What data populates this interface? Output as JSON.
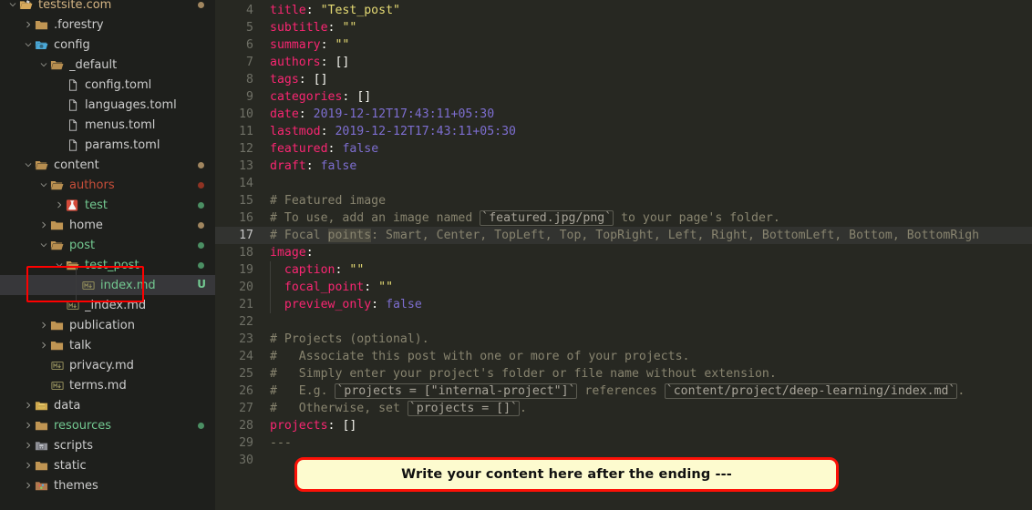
{
  "theme": {
    "sidebar_bg": "#1e1f1c",
    "editor_bg": "#272822",
    "selected_row_bg": "#37373a",
    "active_line_bg": "#323330",
    "annotation_red": "#ff0000",
    "callout_bg": "#fdfbcf",
    "callout_border": "#fc1107",
    "accent_green": "#73c991",
    "accent_red": "#c74e39",
    "accent_tan": "#d4b483"
  },
  "sidebar": {
    "name": "file-explorer",
    "items": [
      {
        "label": "",
        "indent": 0,
        "twisty": "none",
        "icon": "folder-icon",
        "icon_color": "#c09553",
        "label_class": "c-default",
        "dot": null,
        "badge": null,
        "selected": false,
        "partial_top": true
      },
      {
        "label": "testsite.com",
        "indent": 0,
        "twisty": "down",
        "icon": "folder-open-root-icon",
        "icon_color": "#d7a95c",
        "label_class": "c-tan",
        "dot": "#a1865f",
        "badge": null,
        "selected": false
      },
      {
        "label": ".forestry",
        "indent": 1,
        "twisty": "right",
        "icon": "folder-icon",
        "icon_color": "#c09553",
        "label_class": "c-default",
        "dot": null,
        "badge": null,
        "selected": false
      },
      {
        "label": "config",
        "indent": 1,
        "twisty": "down",
        "icon": "folder-config-icon",
        "icon_color": "#4aa8d8",
        "label_class": "c-default",
        "dot": null,
        "badge": null,
        "selected": false
      },
      {
        "label": "_default",
        "indent": 2,
        "twisty": "down",
        "icon": "folder-open-icon",
        "icon_color": "#c09553",
        "label_class": "c-default",
        "dot": null,
        "badge": null,
        "selected": false
      },
      {
        "label": "config.toml",
        "indent": 3,
        "twisty": "none",
        "icon": "file-icon",
        "icon_color": "#c8c8c8",
        "label_class": "c-default",
        "dot": null,
        "badge": null,
        "selected": false
      },
      {
        "label": "languages.toml",
        "indent": 3,
        "twisty": "none",
        "icon": "file-icon",
        "icon_color": "#c8c8c8",
        "label_class": "c-default",
        "dot": null,
        "badge": null,
        "selected": false
      },
      {
        "label": "menus.toml",
        "indent": 3,
        "twisty": "none",
        "icon": "file-icon",
        "icon_color": "#c8c8c8",
        "label_class": "c-default",
        "dot": null,
        "badge": null,
        "selected": false
      },
      {
        "label": "params.toml",
        "indent": 3,
        "twisty": "none",
        "icon": "file-icon",
        "icon_color": "#c8c8c8",
        "label_class": "c-default",
        "dot": null,
        "badge": null,
        "selected": false
      },
      {
        "label": "content",
        "indent": 1,
        "twisty": "down",
        "icon": "folder-open-icon",
        "icon_color": "#c09553",
        "label_class": "c-default",
        "dot": "#a1865f",
        "badge": null,
        "selected": false
      },
      {
        "label": "authors",
        "indent": 2,
        "twisty": "down",
        "icon": "folder-open-icon",
        "icon_color": "#c09553",
        "label_class": "c-red",
        "dot": "#8f3323",
        "badge": null,
        "selected": false
      },
      {
        "label": "test",
        "indent": 3,
        "twisty": "right",
        "icon": "flask-test-icon",
        "icon_color": "#d44a3a",
        "label_class": "c-green",
        "dot": "#4b8f63",
        "badge": null,
        "selected": false
      },
      {
        "label": "home",
        "indent": 2,
        "twisty": "right",
        "icon": "folder-icon",
        "icon_color": "#c09553",
        "label_class": "c-default",
        "dot": "#a1865f",
        "badge": null,
        "selected": false
      },
      {
        "label": "post",
        "indent": 2,
        "twisty": "down",
        "icon": "folder-open-icon",
        "icon_color": "#c09553",
        "label_class": "c-green",
        "dot": "#4b8f63",
        "badge": null,
        "selected": false
      },
      {
        "label": "test_post",
        "indent": 3,
        "twisty": "down",
        "icon": "folder-open-icon",
        "icon_color": "#c09553",
        "label_class": "c-green",
        "dot": "#4b8f63",
        "badge": null,
        "selected": false
      },
      {
        "label": "index.md",
        "indent": 4,
        "twisty": "none",
        "icon": "markdown-icon",
        "icon_color": "#8f8a5a",
        "label_class": "c-green",
        "dot": null,
        "badge": "U",
        "selected": true
      },
      {
        "label": "_index.md",
        "indent": 3,
        "twisty": "none",
        "icon": "markdown-icon",
        "icon_color": "#8f8a5a",
        "label_class": "c-default",
        "dot": null,
        "badge": null,
        "selected": false
      },
      {
        "label": "publication",
        "indent": 2,
        "twisty": "right",
        "icon": "folder-icon",
        "icon_color": "#c09553",
        "label_class": "c-default",
        "dot": null,
        "badge": null,
        "selected": false
      },
      {
        "label": "talk",
        "indent": 2,
        "twisty": "right",
        "icon": "folder-icon",
        "icon_color": "#c09553",
        "label_class": "c-default",
        "dot": null,
        "badge": null,
        "selected": false
      },
      {
        "label": "privacy.md",
        "indent": 2,
        "twisty": "none",
        "icon": "markdown-icon",
        "icon_color": "#8f8a5a",
        "label_class": "c-default",
        "dot": null,
        "badge": null,
        "selected": false
      },
      {
        "label": "terms.md",
        "indent": 2,
        "twisty": "none",
        "icon": "markdown-icon",
        "icon_color": "#8f8a5a",
        "label_class": "c-default",
        "dot": null,
        "badge": null,
        "selected": false
      },
      {
        "label": "data",
        "indent": 1,
        "twisty": "right",
        "icon": "folder-data-icon",
        "icon_color": "#d0a94e",
        "label_class": "c-default",
        "dot": null,
        "badge": null,
        "selected": false
      },
      {
        "label": "resources",
        "indent": 1,
        "twisty": "right",
        "icon": "folder-icon",
        "icon_color": "#c09553",
        "label_class": "c-green",
        "dot": "#4b8f63",
        "badge": null,
        "selected": false
      },
      {
        "label": "scripts",
        "indent": 1,
        "twisty": "right",
        "icon": "folder-scripts-icon",
        "icon_color": "#8f9096",
        "label_class": "c-default",
        "dot": null,
        "badge": null,
        "selected": false
      },
      {
        "label": "static",
        "indent": 1,
        "twisty": "right",
        "icon": "folder-icon",
        "icon_color": "#c09553",
        "label_class": "c-default",
        "dot": null,
        "badge": null,
        "selected": false
      },
      {
        "label": "themes",
        "indent": 1,
        "twisty": "right",
        "icon": "folder-themes-icon",
        "icon_color": "#b07a4e",
        "label_class": "c-default",
        "dot": null,
        "badge": null,
        "selected": false
      }
    ]
  },
  "editor": {
    "name": "code-editor",
    "filename": "index.md",
    "first_visible_line": 4,
    "active_line": 17,
    "selected_word": "points",
    "lines": [
      {
        "n": 4,
        "indent_guides": 0,
        "active": false,
        "tokens": [
          {
            "t": "key",
            "v": "title"
          },
          {
            "t": "punc",
            "v": ":"
          },
          {
            "t": "plain",
            "v": " "
          },
          {
            "t": "str",
            "v": "\"Test_post\""
          }
        ]
      },
      {
        "n": 5,
        "indent_guides": 0,
        "active": false,
        "tokens": [
          {
            "t": "key",
            "v": "subtitle"
          },
          {
            "t": "punc",
            "v": ":"
          },
          {
            "t": "plain",
            "v": " "
          },
          {
            "t": "str",
            "v": "\"\""
          }
        ]
      },
      {
        "n": 6,
        "indent_guides": 0,
        "active": false,
        "tokens": [
          {
            "t": "key",
            "v": "summary"
          },
          {
            "t": "punc",
            "v": ":"
          },
          {
            "t": "plain",
            "v": " "
          },
          {
            "t": "str",
            "v": "\"\""
          }
        ]
      },
      {
        "n": 7,
        "indent_guides": 0,
        "active": false,
        "tokens": [
          {
            "t": "key",
            "v": "authors"
          },
          {
            "t": "punc",
            "v": ":"
          },
          {
            "t": "plain",
            "v": " "
          },
          {
            "t": "bracket",
            "v": "[]"
          }
        ]
      },
      {
        "n": 8,
        "indent_guides": 0,
        "active": false,
        "tokens": [
          {
            "t": "key",
            "v": "tags"
          },
          {
            "t": "punc",
            "v": ":"
          },
          {
            "t": "plain",
            "v": " "
          },
          {
            "t": "bracket",
            "v": "[]"
          }
        ]
      },
      {
        "n": 9,
        "indent_guides": 0,
        "active": false,
        "tokens": [
          {
            "t": "key",
            "v": "categories"
          },
          {
            "t": "punc",
            "v": ":"
          },
          {
            "t": "plain",
            "v": " "
          },
          {
            "t": "bracket",
            "v": "[]"
          }
        ]
      },
      {
        "n": 10,
        "indent_guides": 0,
        "active": false,
        "tokens": [
          {
            "t": "key",
            "v": "date"
          },
          {
            "t": "punc",
            "v": ":"
          },
          {
            "t": "plain",
            "v": " "
          },
          {
            "t": "num",
            "v": "2019-12-12T17:43:11+05:30"
          }
        ]
      },
      {
        "n": 11,
        "indent_guides": 0,
        "active": false,
        "tokens": [
          {
            "t": "key",
            "v": "lastmod"
          },
          {
            "t": "punc",
            "v": ":"
          },
          {
            "t": "plain",
            "v": " "
          },
          {
            "t": "num",
            "v": "2019-12-12T17:43:11+05:30"
          }
        ]
      },
      {
        "n": 12,
        "indent_guides": 0,
        "active": false,
        "tokens": [
          {
            "t": "key",
            "v": "featured"
          },
          {
            "t": "punc",
            "v": ":"
          },
          {
            "t": "plain",
            "v": " "
          },
          {
            "t": "bool",
            "v": "false"
          }
        ]
      },
      {
        "n": 13,
        "indent_guides": 0,
        "active": false,
        "tokens": [
          {
            "t": "key",
            "v": "draft"
          },
          {
            "t": "punc",
            "v": ":"
          },
          {
            "t": "plain",
            "v": " "
          },
          {
            "t": "bool",
            "v": "false"
          }
        ]
      },
      {
        "n": 14,
        "indent_guides": 0,
        "active": false,
        "tokens": []
      },
      {
        "n": 15,
        "indent_guides": 0,
        "active": false,
        "tokens": [
          {
            "t": "comment",
            "v": "# Featured image"
          }
        ]
      },
      {
        "n": 16,
        "indent_guides": 0,
        "active": false,
        "tokens": [
          {
            "t": "comment",
            "v": "# To use, add an image named "
          },
          {
            "t": "code",
            "v": "`featured.jpg/png`"
          },
          {
            "t": "comment",
            "v": " to your page's folder."
          }
        ]
      },
      {
        "n": 17,
        "indent_guides": 0,
        "active": true,
        "tokens": [
          {
            "t": "comment",
            "v": "# Focal "
          },
          {
            "t": "sel",
            "v": "points"
          },
          {
            "t": "comment",
            "v": ": Smart, Center, TopLeft, Top, TopRight, Left, Right, BottomLeft, Bottom, BottomRigh"
          }
        ]
      },
      {
        "n": 18,
        "indent_guides": 0,
        "active": false,
        "tokens": [
          {
            "t": "key",
            "v": "image"
          },
          {
            "t": "punc",
            "v": ":"
          }
        ]
      },
      {
        "n": 19,
        "indent_guides": 1,
        "active": false,
        "tokens": [
          {
            "t": "plain",
            "v": "  "
          },
          {
            "t": "key",
            "v": "caption"
          },
          {
            "t": "punc",
            "v": ":"
          },
          {
            "t": "plain",
            "v": " "
          },
          {
            "t": "str",
            "v": "\"\""
          }
        ]
      },
      {
        "n": 20,
        "indent_guides": 1,
        "active": false,
        "tokens": [
          {
            "t": "plain",
            "v": "  "
          },
          {
            "t": "key",
            "v": "focal_point"
          },
          {
            "t": "punc",
            "v": ":"
          },
          {
            "t": "plain",
            "v": " "
          },
          {
            "t": "str",
            "v": "\"\""
          }
        ]
      },
      {
        "n": 21,
        "indent_guides": 1,
        "active": false,
        "tokens": [
          {
            "t": "plain",
            "v": "  "
          },
          {
            "t": "key",
            "v": "preview_only"
          },
          {
            "t": "punc",
            "v": ":"
          },
          {
            "t": "plain",
            "v": " "
          },
          {
            "t": "bool",
            "v": "false"
          }
        ]
      },
      {
        "n": 22,
        "indent_guides": 0,
        "active": false,
        "tokens": []
      },
      {
        "n": 23,
        "indent_guides": 0,
        "active": false,
        "tokens": [
          {
            "t": "comment",
            "v": "# Projects (optional)."
          }
        ]
      },
      {
        "n": 24,
        "indent_guides": 0,
        "active": false,
        "tokens": [
          {
            "t": "comment",
            "v": "#   Associate this post with one or more of your projects."
          }
        ]
      },
      {
        "n": 25,
        "indent_guides": 0,
        "active": false,
        "tokens": [
          {
            "t": "comment",
            "v": "#   Simply enter your project's folder or file name without extension."
          }
        ]
      },
      {
        "n": 26,
        "indent_guides": 0,
        "active": false,
        "tokens": [
          {
            "t": "comment",
            "v": "#   E.g. "
          },
          {
            "t": "code",
            "v": "`projects = [\"internal-project\"]`"
          },
          {
            "t": "comment",
            "v": " references "
          },
          {
            "t": "code",
            "v": "`content/project/deep-learning/index.md`"
          },
          {
            "t": "comment",
            "v": "."
          }
        ]
      },
      {
        "n": 27,
        "indent_guides": 0,
        "active": false,
        "tokens": [
          {
            "t": "comment",
            "v": "#   Otherwise, set "
          },
          {
            "t": "code",
            "v": "`projects = []`"
          },
          {
            "t": "comment",
            "v": "."
          }
        ]
      },
      {
        "n": 28,
        "indent_guides": 0,
        "active": false,
        "tokens": [
          {
            "t": "key",
            "v": "projects"
          },
          {
            "t": "punc",
            "v": ":"
          },
          {
            "t": "plain",
            "v": " "
          },
          {
            "t": "bracket",
            "v": "[]"
          }
        ]
      },
      {
        "n": 29,
        "indent_guides": 0,
        "active": false,
        "tokens": [
          {
            "t": "comment",
            "v": "---"
          }
        ]
      },
      {
        "n": 30,
        "indent_guides": 0,
        "active": false,
        "tokens": []
      }
    ]
  },
  "annotations": {
    "highlight_rect": {
      "name": "red-highlight-rectangle",
      "target": "test_post / index.md"
    },
    "callout": {
      "name": "instruction-callout",
      "text": "Write your content here after the ending ---"
    }
  }
}
